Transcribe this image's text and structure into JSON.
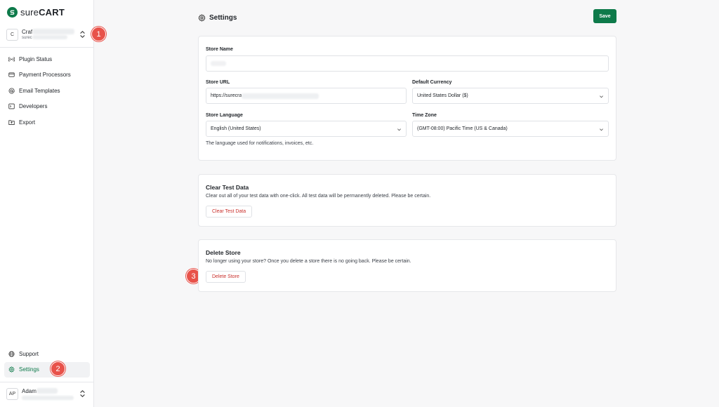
{
  "brand": {
    "logo_text_light": "sure",
    "logo_text_bold": "CART",
    "accent": "#0e7a4a",
    "badge_color": "#e8524a"
  },
  "store_switcher": {
    "initial": "C",
    "name": "Craf",
    "sub": "surec",
    "icon": "chevron-updown-icon"
  },
  "nav": {
    "items": [
      {
        "label": "Plugin Status",
        "icon": "broadcast-icon"
      },
      {
        "label": "Payment Processors",
        "icon": "credit-card-icon"
      },
      {
        "label": "Email Templates",
        "icon": "at-sign-icon"
      },
      {
        "label": "Developers",
        "icon": "terminal-icon"
      },
      {
        "label": "Export",
        "icon": "export-folder-icon"
      }
    ],
    "bottom": [
      {
        "label": "Support",
        "icon": "globe-icon"
      },
      {
        "label": "Settings",
        "icon": "gear-icon",
        "active": true
      }
    ]
  },
  "user": {
    "initials": "AP",
    "name": "Adam"
  },
  "badges": {
    "one": "1",
    "two": "2",
    "three": "3"
  },
  "header": {
    "title": "Settings",
    "icon": "gear-icon",
    "save_label": "Save"
  },
  "store_form": {
    "store_name_label": "Store Name",
    "store_name_value": "",
    "store_url_label": "Store URL",
    "store_url_value": "https://surecra",
    "currency_label": "Default Currency",
    "currency_value": "United States Dollar ($)",
    "language_label": "Store Language",
    "language_value": "English (United States)",
    "timezone_label": "Time Zone",
    "timezone_value": "(GMT-08:00) Pacific Time (US & Canada)",
    "language_help": "The language used for notifications, invoices, etc."
  },
  "clear_test": {
    "title": "Clear Test Data",
    "description": "Clear out all of your test data with one-click. All test data will be permanently deleted. Please be certain.",
    "button": "Clear Test Data"
  },
  "delete_store": {
    "title": "Delete Store",
    "description": "No longer using your store? Once you delete a store there is no going back. Please be certain.",
    "button": "Delete Store"
  }
}
